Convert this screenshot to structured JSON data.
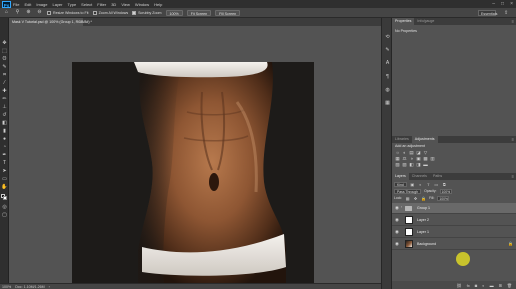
{
  "menubar": {
    "logo": "Ps",
    "items": [
      "File",
      "Edit",
      "Image",
      "Layer",
      "Type",
      "Select",
      "Filter",
      "3D",
      "View",
      "Window",
      "Help"
    ]
  },
  "options": {
    "resize_windows": "Resize Windows to Fit",
    "zoom_all_windows": "Zoom All Windows",
    "scrubby_zoom": "Scrubby Zoom",
    "btn_100": "100%",
    "btn_fit": "Fit Screen",
    "btn_fill": "Fill Screen",
    "workspace": "Essentials"
  },
  "document": {
    "tab_title": "Mask V Tutorial.psd @ 100% (Group 1, RGB/8#) *",
    "close": "×"
  },
  "status": {
    "zoom": "100%",
    "doc_info": "Doc: 1.10M/1.26M"
  },
  "properties": {
    "tabs": [
      "Properties",
      "Info/gauge"
    ],
    "empty_text": "No Properties"
  },
  "adjustments": {
    "tabs": [
      "Libraries",
      "Adjustments"
    ],
    "label": "Add an adjustment",
    "row1": [
      "☼",
      "◐",
      "▤",
      "◪",
      "▽"
    ],
    "row2": [
      "▦",
      "⚖",
      "◑",
      "▣",
      "▩",
      "▥"
    ],
    "row3": [
      "▧",
      "▨",
      "◧",
      "◨",
      "▬"
    ]
  },
  "layers": {
    "tabs": [
      "Layers",
      "Channels",
      "Paths"
    ],
    "filter_kind": "Kind",
    "blend_mode": "Pass Through",
    "opacity_label": "Opacity:",
    "opacity_value": "100%",
    "lock_label": "Lock:",
    "fill_label": "Fill:",
    "fill_value": "100%",
    "items": [
      {
        "name": "Group 1",
        "type": "group",
        "selected": true
      },
      {
        "name": "Layer 1",
        "type": "layer",
        "selected": false
      },
      {
        "name": "Layer 2",
        "type": "layer",
        "selected": false
      },
      {
        "name": "Background",
        "type": "photo",
        "selected": false
      }
    ]
  },
  "colors": {
    "accent": "#31a8ff",
    "cursor_highlight": "#cfc92a"
  }
}
